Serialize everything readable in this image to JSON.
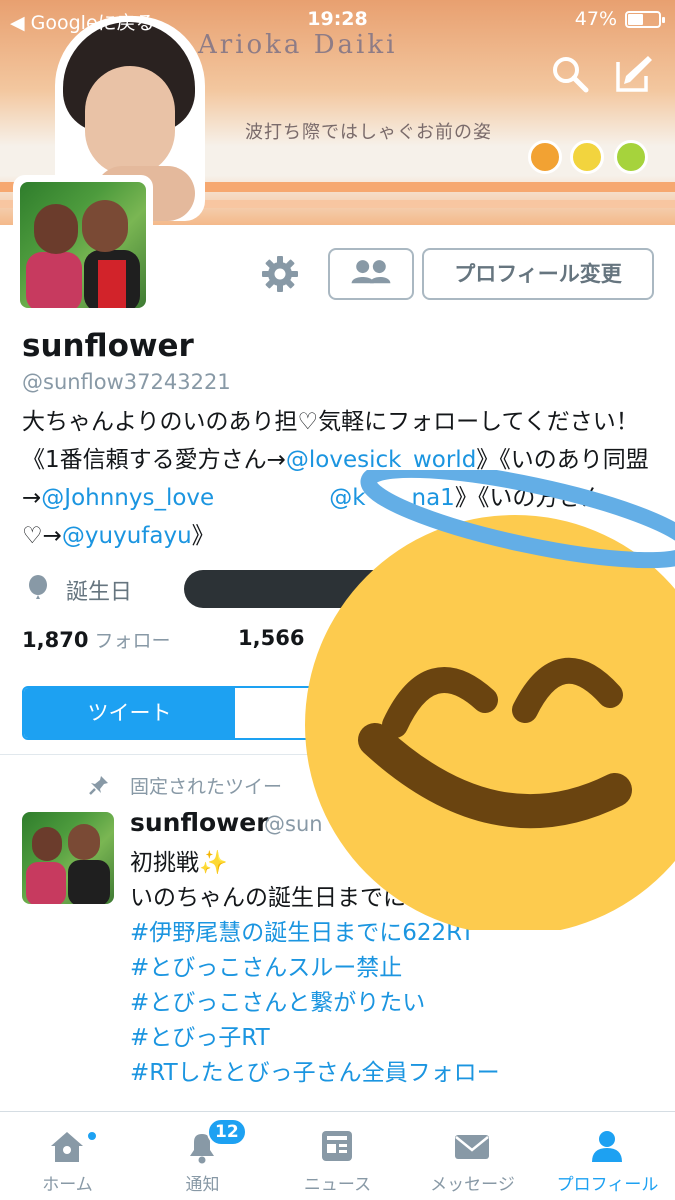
{
  "status_bar": {
    "back_label": "◀ Googleに戻る",
    "time": "19:28",
    "battery_text": "47%",
    "battery_level": 0.47
  },
  "header": {
    "banner_caption": "Arioka Daiki",
    "banner_subcaption": "波打ち際ではしゃぐお前の姿",
    "search_icon": "search-icon",
    "compose_icon": "compose-icon"
  },
  "profile": {
    "name": "sunflower",
    "handle": "@sunflow37243221",
    "bio": [
      {
        "text": "大ちゃんよりのいのあり担♡気軽にフォローしてくださ",
        "link": false
      },
      {
        "text": "い！《1番信頼する愛方さん→",
        "link": false
      },
      {
        "text": "@lovesick_world",
        "link": true
      },
      {
        "text": "》《い",
        "link": false
      },
      {
        "text": "のあり同盟→",
        "link": false
      },
      {
        "text": "@Johnnys_love",
        "link": true
      },
      {
        "text": "　　　　　",
        "link": false
      },
      {
        "text": "@k",
        "link": true
      },
      {
        "text": "　　",
        "link": false
      },
      {
        "text": "na1",
        "link": true
      },
      {
        "text": "》《い",
        "link": false
      },
      {
        "text": "の方さん♡→",
        "link": false
      },
      {
        "text": "@yuyufayu",
        "link": true
      },
      {
        "text": "》",
        "link": false
      }
    ],
    "birthday_label": "誕生日",
    "edit_profile_label": "プロフィール変更",
    "following_count": "1,870",
    "following_label": "フォロー",
    "followers_count": "1,566",
    "tab_tweets_label": "ツイート"
  },
  "pinned_tweet": {
    "pinned_label": "固定されたツイー",
    "name": "sunflower",
    "handle": "@sun",
    "line1": "初挑戦",
    "line1_emoji": "✨",
    "line2": "いのちゃんの誕生日までに",
    "hashtags": [
      "#伊野尾慧の誕生日までに622RT",
      "#とびっこさんスルー禁止",
      "#とびっこさんと繋がりたい",
      "#とびっ子RT",
      "#RTしたとびっ子さん全員フォロー"
    ]
  },
  "tabbar": {
    "items": [
      {
        "label": "ホーム",
        "icon": "home-icon",
        "active": false
      },
      {
        "label": "通知",
        "icon": "bell-icon",
        "active": false,
        "badge": "12"
      },
      {
        "label": "ニュース",
        "icon": "news-icon",
        "active": false
      },
      {
        "label": "メッセージ",
        "icon": "envelope-icon",
        "active": false
      },
      {
        "label": "プロフィール",
        "icon": "person-icon",
        "active": true
      }
    ]
  },
  "colors": {
    "accent": "#1da1f2",
    "link": "#1b95e0",
    "muted": "#8899a6"
  },
  "overlay": {
    "icon": "smiling-face-with-halo-emoji"
  }
}
